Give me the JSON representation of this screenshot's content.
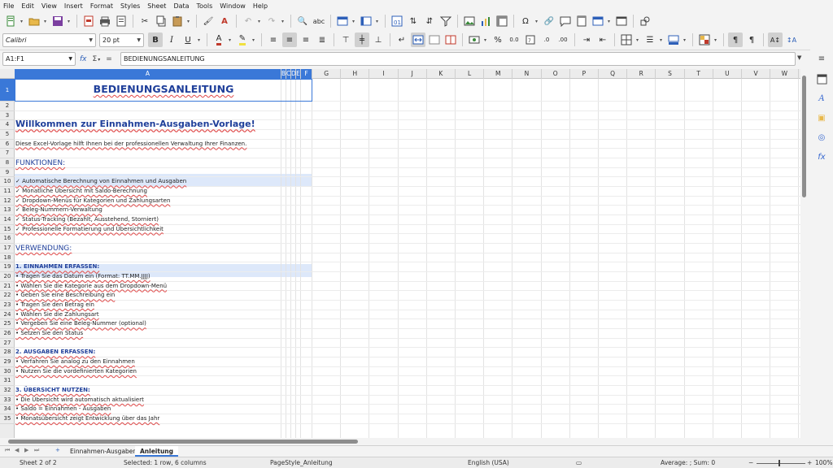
{
  "menu": [
    "File",
    "Edit",
    "View",
    "Insert",
    "Format",
    "Styles",
    "Sheet",
    "Data",
    "Tools",
    "Window",
    "Help"
  ],
  "font": {
    "name": "Calibri",
    "size": "20 pt"
  },
  "formula_bar": {
    "cell_ref": "A1:F1",
    "content": "BEDIENUNGSANLEITUNG",
    "fx": "fx",
    "sigma": "Σ",
    "equals": "="
  },
  "columns": [
    "A",
    "B",
    "C",
    "D",
    "E",
    "F",
    "G",
    "H",
    "I",
    "J",
    "K",
    "L",
    "M",
    "N",
    "O",
    "P",
    "Q",
    "R",
    "S",
    "T",
    "U",
    "V",
    "W"
  ],
  "rows": [
    "1",
    "2",
    "3",
    "4",
    "5",
    "6",
    "7",
    "8",
    "9",
    "10",
    "11",
    "12",
    "13",
    "14",
    "15",
    "16",
    "17",
    "18",
    "19",
    "20",
    "21",
    "22",
    "23",
    "24",
    "25",
    "26",
    "27",
    "28",
    "29",
    "30",
    "31",
    "32",
    "33",
    "34",
    "35"
  ],
  "cells": {
    "r1": "BEDIENUNGSANLEITUNG",
    "r4": "Willkommen zur Einnahmen-Ausgaben-Vorlage!",
    "r6": "Diese Excel-Vorlage hilft Ihnen bei der professionellen Verwaltung Ihrer Finanzen.",
    "r8": "FUNKTIONEN:",
    "r10": "✓ Automatische Berechnung von Einnahmen und Ausgaben",
    "r11": "✓ Monatliche Übersicht mit Saldo-Berechnung",
    "r12": "✓ Dropdown-Menüs für Kategorien und Zahlungsarten",
    "r13": "✓ Beleg-Nummern-Verwaltung",
    "r14": "✓ Status-Tracking (Bezahlt, Ausstehend, Storniert)",
    "r15": "✓ Professionelle Formatierung und Übersichtlichkeit",
    "r17": "VERWENDUNG:",
    "r19": "1. EINNAHMEN ERFASSEN:",
    "r20": "• Tragen Sie das Datum ein (Format: TT.MM.JJJJ)",
    "r21": "• Wählen Sie die Kategorie aus dem Dropdown-Menü",
    "r22": "• Geben Sie eine Beschreibung ein",
    "r23": "• Tragen Sie den Betrag ein",
    "r24": "• Wählen Sie die Zahlungsart",
    "r25": "• Vergeben Sie eine Beleg-Nummer (optional)",
    "r26": "• Setzen Sie den Status",
    "r28": "2. AUSGABEN ERFASSEN:",
    "r29": "• Verfahren Sie analog zu den Einnahmen",
    "r30": "• Nutzen Sie die vordefinierten Kategorien",
    "r32": "3. ÜBERSICHT NUTZEN:",
    "r33": "• Die Übersicht wird automatisch aktualisiert",
    "r34": "• Saldo = Einnahmen - Ausgaben",
    "r35": "• Monatsübersicht zeigt Entwicklung über das Jahr"
  },
  "tabs": [
    "Einnahmen-Ausgaben",
    "Anleitung"
  ],
  "active_tab": "Anleitung",
  "tab_add": "+",
  "status": {
    "sheet": "Sheet 2 of 2",
    "selection": "Selected: 1 row, 6 columns",
    "page_style": "PageStyle_Anleitung",
    "language": "English (USA)",
    "summary": "Average: ; Sum: 0",
    "zoom": "100%"
  },
  "colors": {
    "accent": "#3a78d8",
    "heading": "#1f3f9a",
    "band": "#dde8fa"
  }
}
